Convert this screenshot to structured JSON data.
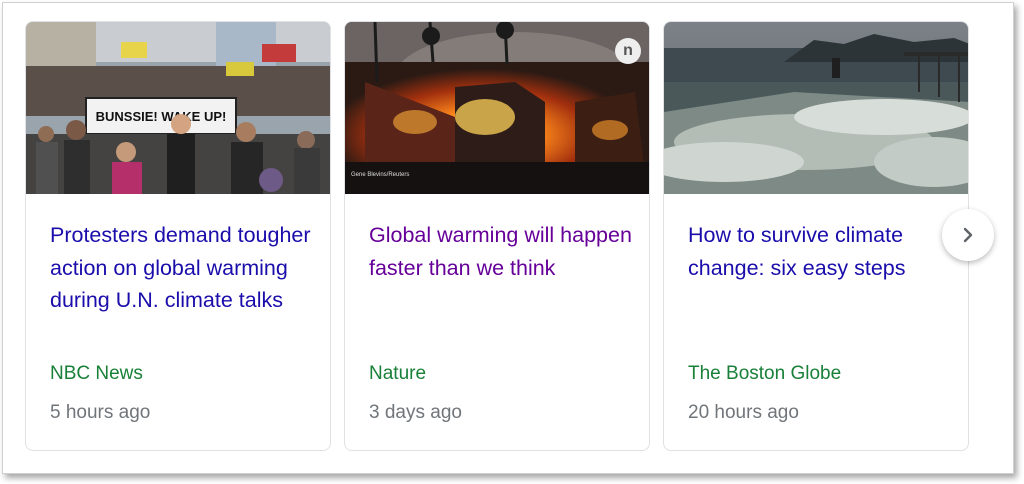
{
  "cards": [
    {
      "headline": "Protesters demand tougher action on global warming during U.N. climate talks",
      "source": "NBC News",
      "time": "5 hours ago",
      "image": "protest-crowd-with-banner",
      "banner_text": "BUNSSIE! WAKE UP!"
    },
    {
      "headline": "Global warming will happen faster than we think",
      "source": "Nature",
      "time": "3 days ago",
      "image": "burning-house-wildfire",
      "publisher_badge": "n",
      "photo_credit": "Gene Blevins/Reuters"
    },
    {
      "headline": "How to survive climate change: six easy steps",
      "source": "The Boston Globe",
      "time": "20 hours ago",
      "image": "storm-waves-over-seawall"
    }
  ],
  "next_button": {
    "icon": "chevron-right-icon"
  },
  "colors": {
    "link": "#1a0dab",
    "visited_link": "#660099",
    "source": "#188038",
    "meta": "#70757a",
    "card_border": "#dfe1e5"
  }
}
